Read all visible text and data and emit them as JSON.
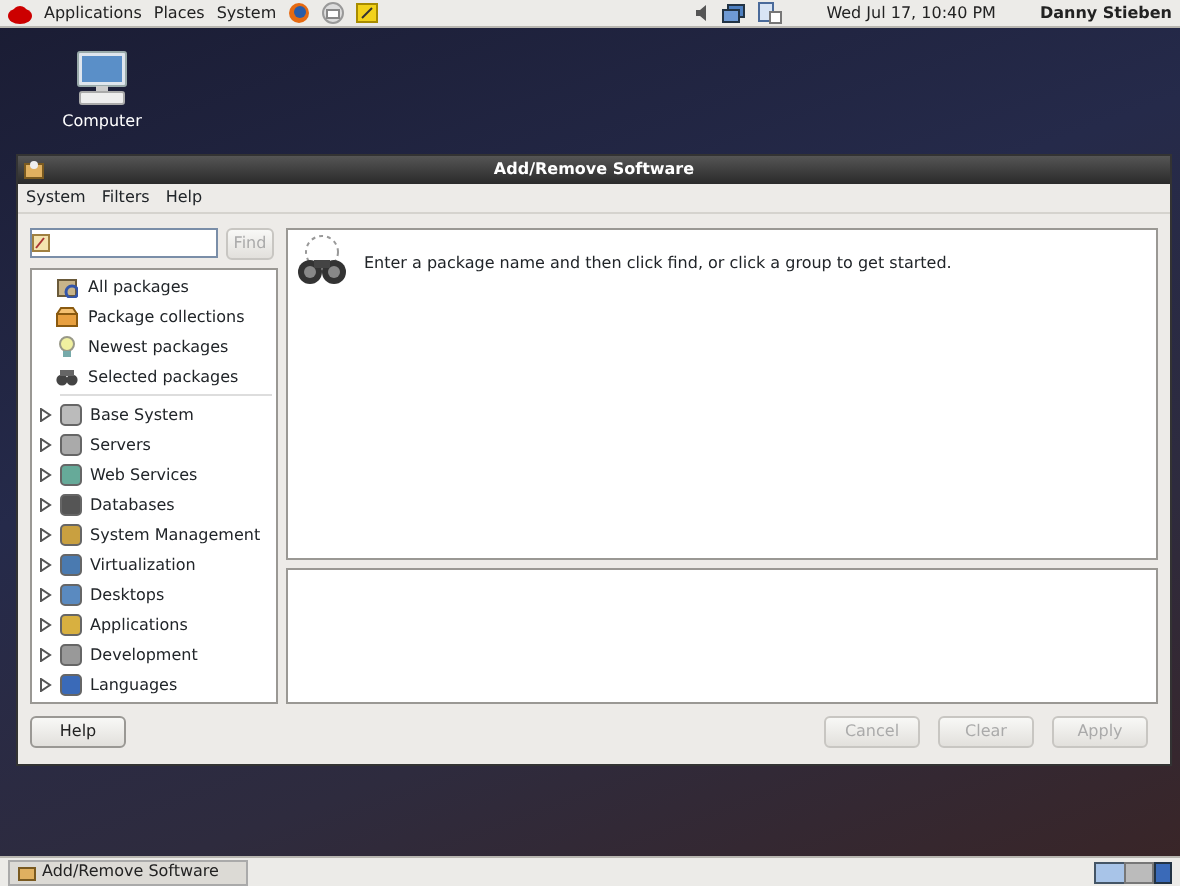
{
  "top_panel": {
    "menus": [
      "Applications",
      "Places",
      "System"
    ],
    "clock": "Wed Jul 17, 10:40 PM",
    "user": "Danny Stieben"
  },
  "desktop": {
    "icons": [
      {
        "label": "Computer"
      }
    ]
  },
  "window": {
    "title": "Add/Remove Software",
    "menu": [
      "System",
      "Filters",
      "Help"
    ],
    "search": {
      "find": {
        "label": "Find",
        "disabled": true
      }
    },
    "groups": [
      {
        "label": "All packages",
        "kind": "view"
      },
      {
        "label": "Package collections",
        "kind": "view"
      },
      {
        "label": "Newest packages",
        "kind": "view"
      },
      {
        "label": "Selected packages",
        "kind": "view"
      }
    ],
    "categories": [
      {
        "label": "Base System",
        "expanded": false
      },
      {
        "label": "Servers",
        "expanded": false
      },
      {
        "label": "Web Services",
        "expanded": false
      },
      {
        "label": "Databases",
        "expanded": false
      },
      {
        "label": "System Management",
        "expanded": false
      },
      {
        "label": "Virtualization",
        "expanded": false
      },
      {
        "label": "Desktops",
        "expanded": false
      },
      {
        "label": "Applications",
        "expanded": false
      },
      {
        "label": "Development",
        "expanded": false
      },
      {
        "label": "Languages",
        "expanded": false
      }
    ],
    "message": "Enter a package name and then click find, or click a group to get started.",
    "buttons": [
      {
        "label": "Help",
        "disabled": false,
        "kind": "left"
      },
      {
        "label": "Cancel",
        "disabled": true,
        "kind": "right"
      },
      {
        "label": "Clear",
        "disabled": true,
        "kind": "right"
      },
      {
        "label": "Apply",
        "disabled": true,
        "kind": "right"
      }
    ]
  },
  "taskbar": {
    "tasks": [
      {
        "label": "Add/Remove Software",
        "selected": false
      }
    ]
  }
}
